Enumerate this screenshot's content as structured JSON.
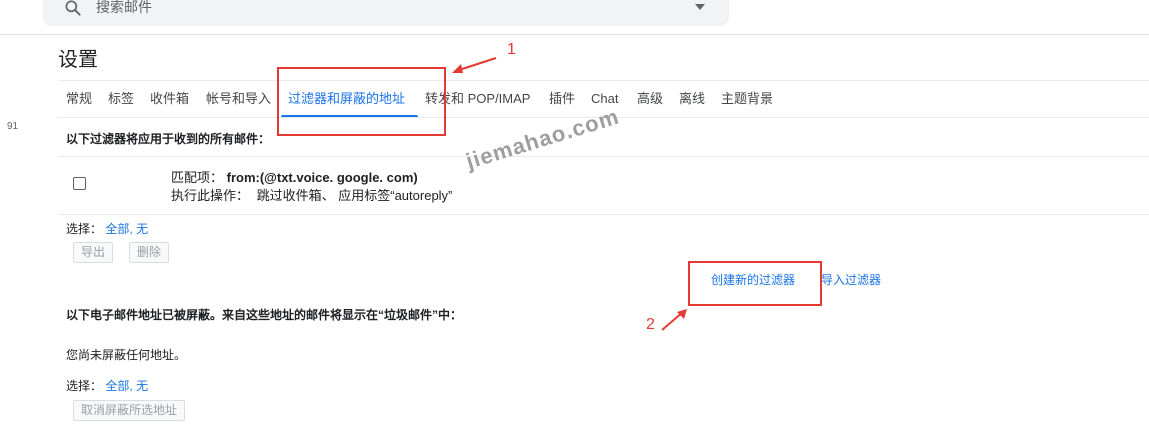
{
  "search": {
    "placeholder": "搜索邮件"
  },
  "page": {
    "title": "设置"
  },
  "left_count": "91",
  "tabs": [
    {
      "label": "常规"
    },
    {
      "label": "标签"
    },
    {
      "label": "收件箱"
    },
    {
      "label": "帐号和导入"
    },
    {
      "label": "过滤器和屏蔽的地址",
      "active": true
    },
    {
      "label": "转发和 POP/IMAP"
    },
    {
      "label": "插件"
    },
    {
      "label": "Chat"
    },
    {
      "label": "高级"
    },
    {
      "label": "离线"
    },
    {
      "label": "主题背景"
    }
  ],
  "filters_section": {
    "heading": "以下过滤器将应用于收到的所有邮件：",
    "filters": [
      {
        "match_label": "匹配项：",
        "match_value": "from:(@txt.voice. google. com)",
        "action_label": "执行此操作：",
        "action_value": "跳过收件箱、 应用标签“autoreply”"
      }
    ],
    "select_label": "选择：",
    "select_all": "全部",
    "select_sep": ",",
    "select_none": "无",
    "export_button": "导出",
    "delete_button": "删除",
    "create_filter_link": "创建新的过滤器",
    "import_filters_link": "导入过滤器"
  },
  "blocked_section": {
    "heading": "以下电子邮件地址已被屏蔽。来自这些地址的邮件将显示在“垃圾邮件”中：",
    "empty_text": "您尚未屏蔽任何地址。",
    "select_label": "选择：",
    "select_all": "全部",
    "select_sep": ",",
    "select_none": "无",
    "unblock_button": "取消屏蔽所选地址"
  },
  "annotations": {
    "marker_1": "1",
    "marker_2": "2"
  },
  "watermark": "jiemahao.com",
  "colors": {
    "accent": "#1a73e8",
    "annotation": "#e53935"
  }
}
